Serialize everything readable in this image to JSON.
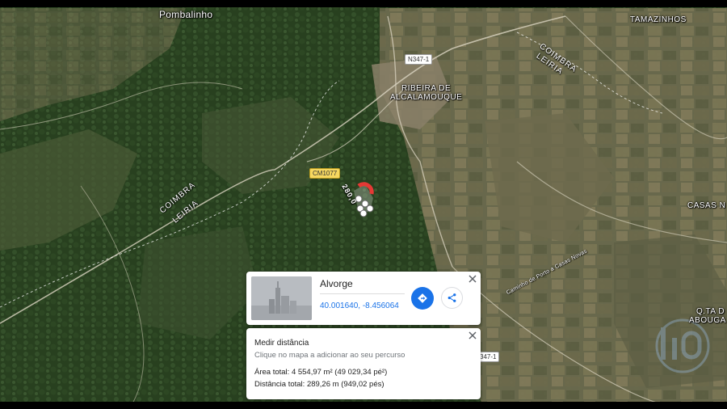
{
  "map": {
    "places": {
      "pombalinho": "Pombalinho",
      "tamazinhos": "TAMAZINHOS",
      "ribeira_line1": "RIBEIRA DE",
      "ribeira_line2": "ALCALAMOUQUE",
      "casas_novas": "CASAS N",
      "qta_line1": "Q.TA D",
      "qta_line2": "ABOUGA"
    },
    "roads": {
      "n347_top": "N347-1",
      "cm1077": "CM1077",
      "n347_bottom": "347-1",
      "coimbra_leiria_left": [
        "COIMBRA",
        "LEIRIA"
      ],
      "coimbra_leiria_right": [
        "COIMBRA",
        "LEIRIA"
      ],
      "caminho": "Caminho de Porto a Casas Novas"
    },
    "measure_label": "280,0",
    "icons": {
      "directions": "directions-icon",
      "share": "share-icon",
      "close": "close-icon"
    },
    "colors": {
      "accent": "#1a73e8",
      "measure_point": "#ffffff",
      "measure_marker": "#e53935"
    }
  },
  "place_card": {
    "name": "Alvorge",
    "coordinates": "40.001640, -8.456064"
  },
  "measure_card": {
    "title": "Medir distância",
    "hint": "Clique no mapa a adicionar ao seu percurso",
    "area": "Área total: 4 554,97 m² (49 029,34 pé²)",
    "distance": "Distância total: 289,26 m (949,02 pés)"
  }
}
